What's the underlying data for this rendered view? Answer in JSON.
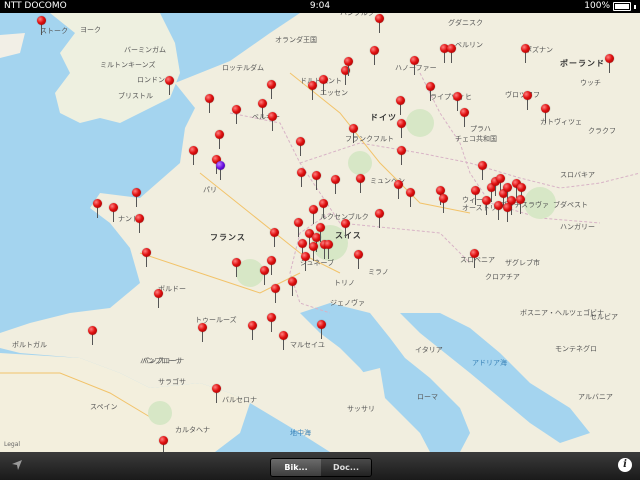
{
  "status": {
    "carrier": "NTT DOCOMO",
    "time": "9:04",
    "battery": "100%"
  },
  "toolbar": {
    "tabs": [
      {
        "label": "Bik...",
        "active": true
      },
      {
        "label": "Doc...",
        "active": false
      }
    ],
    "info": "i"
  },
  "legal": "Legal",
  "labels": [
    {
      "t": "フランス",
      "c": "country"
    },
    {
      "t": "スイス",
      "c": "country"
    },
    {
      "t": "ドイツ",
      "c": "country"
    },
    {
      "t": "オーストリア",
      "c": ""
    },
    {
      "t": "イタリア",
      "c": ""
    },
    {
      "t": "スペイン",
      "c": ""
    },
    {
      "t": "チェコ共和国",
      "c": ""
    },
    {
      "t": "ポーランド",
      "c": "country"
    },
    {
      "t": "スロバキア",
      "c": ""
    },
    {
      "t": "ハンガリー",
      "c": ""
    },
    {
      "t": "スロベニア",
      "c": ""
    },
    {
      "t": "クロアチア",
      "c": ""
    },
    {
      "t": "ボスニア・ヘルツェゴビナ",
      "c": ""
    },
    {
      "t": "セルビア",
      "c": ""
    },
    {
      "t": "モンテネグロ",
      "c": ""
    },
    {
      "t": "アルバニア",
      "c": ""
    },
    {
      "t": "オランダ王国",
      "c": ""
    },
    {
      "t": "ベルギー",
      "c": ""
    },
    {
      "t": "パリ",
      "c": ""
    },
    {
      "t": "ロンドン",
      "c": ""
    },
    {
      "t": "ブリストル",
      "c": ""
    },
    {
      "t": "バーミンガム",
      "c": ""
    },
    {
      "t": "ミルトンキーンズ",
      "c": ""
    },
    {
      "t": "ボルドー",
      "c": ""
    },
    {
      "t": "トゥールーズ",
      "c": ""
    },
    {
      "t": "マルセイユ",
      "c": ""
    },
    {
      "t": "ナント",
      "c": ""
    },
    {
      "t": "ミラノ",
      "c": ""
    },
    {
      "t": "トリノ",
      "c": ""
    },
    {
      "t": "ジェノヴァ",
      "c": ""
    },
    {
      "t": "フランクフルト",
      "c": ""
    },
    {
      "t": "ハンブルク",
      "c": ""
    },
    {
      "t": "ライプツィヒ",
      "c": ""
    },
    {
      "t": "ヴロツワフ",
      "c": ""
    },
    {
      "t": "プラハ",
      "c": ""
    },
    {
      "t": "ウィーン",
      "c": ""
    },
    {
      "t": "ザグレブ市",
      "c": ""
    },
    {
      "t": "バルセロナ",
      "c": ""
    },
    {
      "t": "サラゴサ",
      "c": ""
    },
    {
      "t": "バンプローナ",
      "c": ""
    },
    {
      "t": "ポズナン",
      "c": ""
    },
    {
      "t": "ウッチ",
      "c": ""
    },
    {
      "t": "クラクフ",
      "c": ""
    },
    {
      "t": "カトヴィツェ",
      "c": ""
    },
    {
      "t": "ブダペスト",
      "c": ""
    },
    {
      "t": "ブラチスラヴァ",
      "c": ""
    },
    {
      "t": "ローマ",
      "c": ""
    },
    {
      "t": "サッサリ",
      "c": ""
    },
    {
      "t": "ベルリン",
      "c": ""
    },
    {
      "t": "ロッテルダム",
      "c": ""
    },
    {
      "t": "ドルトムント",
      "c": ""
    },
    {
      "t": "エッセン",
      "c": ""
    },
    {
      "t": "ミュンヘン",
      "c": ""
    },
    {
      "t": "ジュネーブ",
      "c": ""
    },
    {
      "t": "ポルトガル",
      "c": ""
    },
    {
      "t": "地中海",
      "c": "sea"
    },
    {
      "t": "アドリア海",
      "c": "sea"
    },
    {
      "t": "カルタヘナ",
      "c": ""
    },
    {
      "t": "パンプローナ",
      "c": ""
    },
    {
      "t": "ルクセンブルク",
      "c": ""
    },
    {
      "t": "ハノーファー",
      "c": ""
    },
    {
      "t": "グダニスク",
      "c": ""
    },
    {
      "t": "ストーク",
      "c": ""
    },
    {
      "t": "ヨーク",
      "c": ""
    }
  ]
}
